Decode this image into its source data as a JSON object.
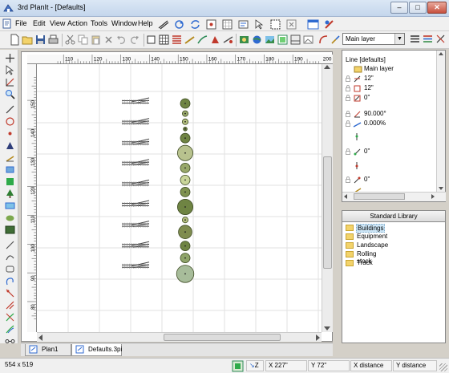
{
  "window": {
    "title": "3rd PlanIt - [Defaults]",
    "minimize_glyph": "–",
    "maximize_glyph": "□",
    "close_glyph": "✕"
  },
  "menu": [
    "File",
    "Edit",
    "View",
    "Action",
    "Tools",
    "Window",
    "Help"
  ],
  "layer_select": {
    "value": "Main layer",
    "dropdown_glyph": "▼"
  },
  "ruler": {
    "h_labels": [
      "110",
      "120",
      "130",
      "140",
      "150",
      "160",
      "170",
      "180",
      "190",
      "200",
      "210"
    ],
    "v_labels": [
      "150",
      "140",
      "130",
      "120",
      "110",
      "100",
      "90",
      "80"
    ]
  },
  "tabs": [
    "Plan1",
    "Defaults.3pi"
  ],
  "properties": {
    "title": "Line [defaults]",
    "rows": [
      "Main layer",
      "12\"",
      "12\"",
      "0\"",
      "90.000°",
      "0.000%",
      "",
      "0\"",
      "",
      "0\""
    ]
  },
  "library": {
    "header": "Standard Library",
    "items": [
      "Buildings",
      "Equipment",
      "Landscape",
      "Rolling stock",
      "Track"
    ],
    "selected_index": 0
  },
  "status": {
    "size": "554 x 519",
    "snap_label": "Z",
    "x": "X 227\"",
    "y": "Y 72\"",
    "x_distance": "X distance",
    "y_distance": "Y distance"
  },
  "canvas": {
    "turnout_count": 9,
    "circles": [
      {
        "d_in": 5.0,
        "fill": "#6f8443"
      },
      {
        "d_in": 3.0,
        "fill": "#98a86a"
      },
      {
        "d_in": 3.0,
        "fill": "#b5c07f"
      },
      {
        "d_in": 2.0,
        "fill": "#6f8443"
      },
      {
        "d_in": 5.0,
        "fill": "#6f8443"
      },
      {
        "d_in": 8.0,
        "fill": "#b8c28e"
      },
      {
        "d_in": 5.0,
        "fill": "#98a86a"
      },
      {
        "d_in": 5.0,
        "fill": "#c9d59a"
      },
      {
        "d_in": 5.0,
        "fill": "#7f9250"
      },
      {
        "d_in": 8.0,
        "fill": "#6f8443"
      },
      {
        "d_in": 3.0,
        "fill": "#b5c07f"
      },
      {
        "d_in": 7.0,
        "fill": "#7f8c4f"
      },
      {
        "d_in": 5.0,
        "fill": "#6f8443"
      },
      {
        "d_in": 5.0,
        "fill": "#8fa46a"
      },
      {
        "d_in": 9.0,
        "fill": "#a7bc9a"
      }
    ]
  },
  "colors": {
    "grid": "#e2e2e2",
    "rail": "#444444",
    "accent": "#316ac5"
  }
}
